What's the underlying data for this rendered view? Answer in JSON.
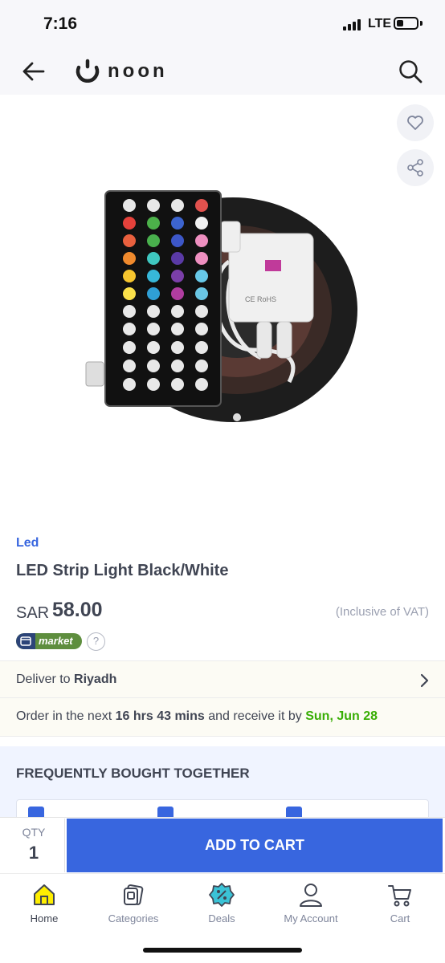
{
  "status_bar": {
    "time": "7:16",
    "network": "LTE"
  },
  "header": {
    "logo_text": "noon",
    "back_icon": "arrow-left-icon",
    "search_icon": "search-icon"
  },
  "product": {
    "brand": "Led",
    "title": "LED Strip Light Black/White",
    "currency": "SAR",
    "price": "58.00",
    "vat_note": "(Inclusive of VAT)",
    "badge": "market",
    "help": "?"
  },
  "delivery": {
    "deliver_prefix": "Deliver to",
    "city": "Riyadh",
    "order_prefix": "Order in the next",
    "countdown": "16 hrs 43 mins",
    "order_middle": "and receive it by",
    "date": "Sun, Jun 28"
  },
  "fbt": {
    "title": "FREQUENTLY BOUGHT TOGETHER"
  },
  "cart": {
    "qty_label": "QTY",
    "qty_value": "1",
    "add_label": "ADD TO CART"
  },
  "nav": {
    "items": [
      {
        "label": "Home",
        "icon": "home-icon"
      },
      {
        "label": "Categories",
        "icon": "categories-icon"
      },
      {
        "label": "Deals",
        "icon": "deals-icon"
      },
      {
        "label": "My Account",
        "icon": "account-icon"
      },
      {
        "label": "Cart",
        "icon": "cart-icon"
      }
    ]
  },
  "colors": {
    "accent_blue": "#3866df",
    "deliver_green": "#38ae04",
    "home_yellow": "#feee00",
    "deals_cyan": "#3bc3d6",
    "market_green": "#5e8e3e"
  }
}
